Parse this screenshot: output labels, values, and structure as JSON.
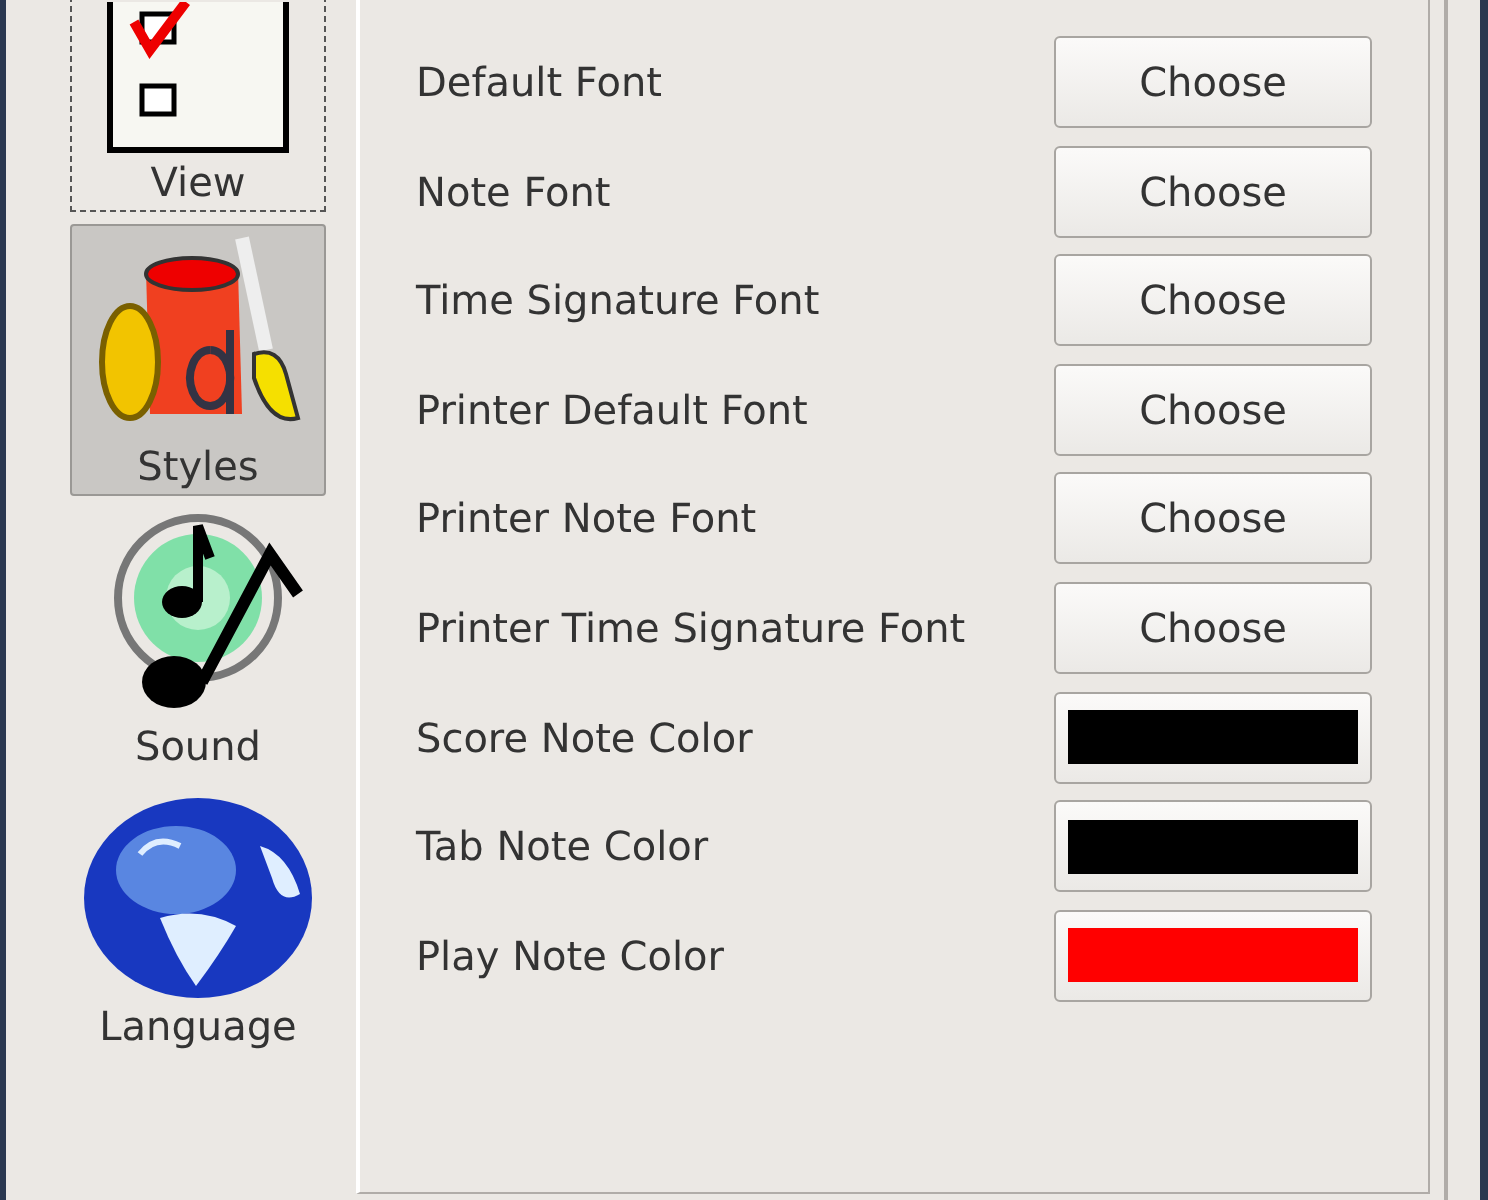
{
  "sidebar": {
    "items": [
      {
        "label": "View",
        "selected": false,
        "focused": true
      },
      {
        "label": "Styles",
        "selected": true,
        "focused": false
      },
      {
        "label": "Sound",
        "selected": false,
        "focused": false
      },
      {
        "label": "Language",
        "selected": false,
        "focused": false
      }
    ]
  },
  "settings": [
    {
      "kind": "font",
      "label": "Default Font",
      "button": "Choose"
    },
    {
      "kind": "font",
      "label": "Note Font",
      "button": "Choose"
    },
    {
      "kind": "font",
      "label": "Time Signature Font",
      "button": "Choose"
    },
    {
      "kind": "font",
      "label": "Printer Default Font",
      "button": "Choose"
    },
    {
      "kind": "font",
      "label": "Printer Note Font",
      "button": "Choose"
    },
    {
      "kind": "font",
      "label": "Printer Time Signature Font",
      "button": "Choose"
    },
    {
      "kind": "color",
      "label": "Score Note Color",
      "color": "#000000"
    },
    {
      "kind": "color",
      "label": "Tab Note Color",
      "color": "#000000"
    },
    {
      "kind": "color",
      "label": "Play Note Color",
      "color": "#ff0000"
    }
  ]
}
